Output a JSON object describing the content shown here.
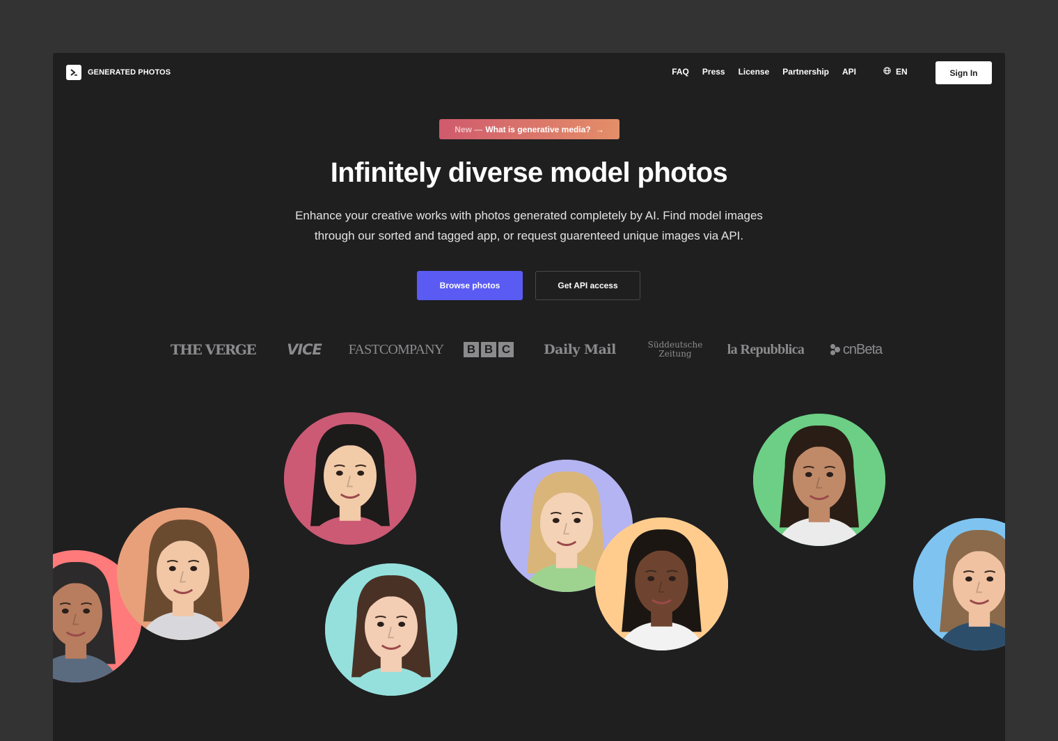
{
  "brand": {
    "name": "GENERATED PHOTOS",
    "logo_glyph": ">"
  },
  "nav": {
    "items": [
      "FAQ",
      "Press",
      "License",
      "Partnership",
      "API"
    ],
    "language": "EN",
    "sign_in": "Sign In"
  },
  "hero": {
    "badge_new": "New —",
    "badge_text": "What is generative media?",
    "badge_arrow": "→",
    "headline": "Infinitely diverse model photos",
    "subline_1": "Enhance your creative works with photos generated completely by AI. Find model images",
    "subline_2": "through our sorted and tagged app, or request guarenteed unique images via API.",
    "primary_cta": "Browse photos",
    "secondary_cta": "Get API access"
  },
  "press_logos": {
    "verge": "THE VERGE",
    "vice": "VICE",
    "fastcompany": "FASTCOMPANY",
    "bbc": [
      "B",
      "B",
      "C"
    ],
    "dailymail": "Daily Mail",
    "sz_line1": "Süddeutsche",
    "sz_line2": "Zeitung",
    "repubblica": "la Repubblica",
    "cnbeta": "cnBeta"
  },
  "colors": {
    "page_bg": "#333334",
    "frame_bg": "#1f1f20",
    "primary": "#5a5bf3",
    "badge_from": "#cf5a6d",
    "badge_to": "#e48f68"
  },
  "faces": [
    {
      "name": "man-dark-hair",
      "bg": "#ff7a7a",
      "skin": "#b77d5e",
      "hair": "#2c2a2a",
      "shirt": "#5a6b80"
    },
    {
      "name": "toddler-boy",
      "bg": "#e8a07a",
      "skin": "#f1c7a6",
      "hair": "#6b4b30",
      "shirt": "#d8d8dc"
    },
    {
      "name": "woman-asian",
      "bg": "#cc5a75",
      "skin": "#f2cba8",
      "hair": "#1d1a1a",
      "shirt": "#cc5a75"
    },
    {
      "name": "woman-brunette",
      "bg": "#95e0dc",
      "skin": "#f3cdb4",
      "hair": "#4a3125",
      "shirt": "#95e0dc"
    },
    {
      "name": "girl-blonde",
      "bg": "#b4b4f2",
      "skin": "#f4d2b5",
      "hair": "#d9b57a",
      "shirt": "#9ed38f"
    },
    {
      "name": "man-black",
      "bg": "#ffcc8e",
      "skin": "#6e4430",
      "hair": "#1c1612",
      "shirt": "#f2f2f2"
    },
    {
      "name": "girl-brown",
      "bg": "#6ccf85",
      "skin": "#c08a68",
      "hair": "#2a1d15",
      "shirt": "#ebebeb"
    },
    {
      "name": "man-blond",
      "bg": "#7fc4f0",
      "skin": "#f0c2a2",
      "hair": "#8a6a4a",
      "shirt": "#2d4e6b"
    }
  ]
}
